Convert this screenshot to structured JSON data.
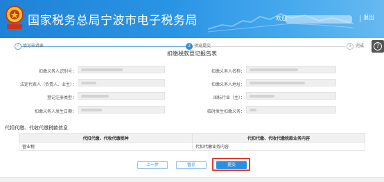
{
  "header": {
    "site_title": "国家税务总局宁波市电子税务局",
    "user_label": "欢迎",
    "logout": "退出"
  },
  "progress": {
    "steps": [
      {
        "num": "✓",
        "label": "填写申请表",
        "state": "done"
      },
      {
        "num": "2",
        "label": "预览提交",
        "state": "active"
      },
      {
        "num": "3",
        "label": "完成",
        "state": "pending"
      }
    ]
  },
  "form": {
    "title": "扣缴税款登记报告表",
    "fields": [
      {
        "label": "扣缴义务人识别号：",
        "value": ""
      },
      {
        "label": "扣缴义务人名称：",
        "value": ""
      },
      {
        "label": "法定代表人（负责人、业主）：",
        "value": ""
      },
      {
        "label": "扣缴义务人地址：",
        "value": ""
      },
      {
        "label": "登记注册类型：",
        "value": ""
      },
      {
        "label": "国标行业（主）：",
        "value": ""
      },
      {
        "label": "扣缴义务人发生日期：",
        "value": ""
      },
      {
        "label": "临时发生扣缴义务：",
        "value": ""
      }
    ]
  },
  "section": {
    "title": "代扣代缴、代收代缴税款信息"
  },
  "table": {
    "headers": [
      "代扣代缴、代收代缴税种",
      "代扣代缴、代收代缴税款业务内容"
    ],
    "rows": [
      [
        "营业税",
        "代扣代缴业务内容"
      ]
    ]
  },
  "buttons": {
    "prev": "上一步",
    "save": "暂存",
    "submit": "提交"
  },
  "colors": {
    "header_start": "#1f82d6",
    "accent": "#2d8ee0",
    "highlight": "#e03c33"
  },
  "icons": [
    "tax-emblem-icon",
    "check-icon",
    "help-icon"
  ]
}
